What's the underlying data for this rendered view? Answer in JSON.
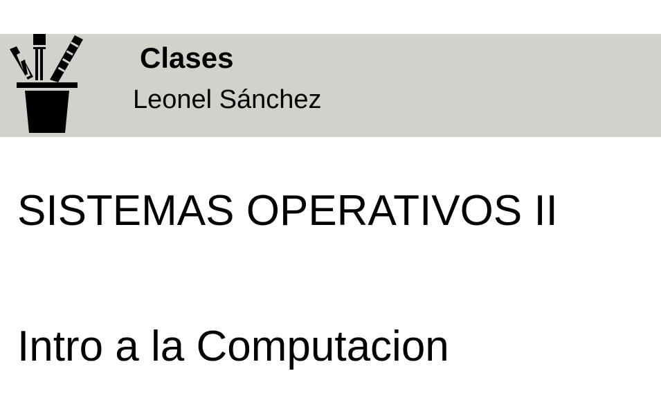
{
  "header": {
    "icon": "pencil-cup-icon",
    "title": "Clases",
    "subtitle": "Leonel Sánchez",
    "background": "#cfd3cb"
  },
  "classes": [
    {
      "label": "SISTEMAS OPERATIVOS II"
    },
    {
      "label": "Intro a la Computacion"
    }
  ]
}
